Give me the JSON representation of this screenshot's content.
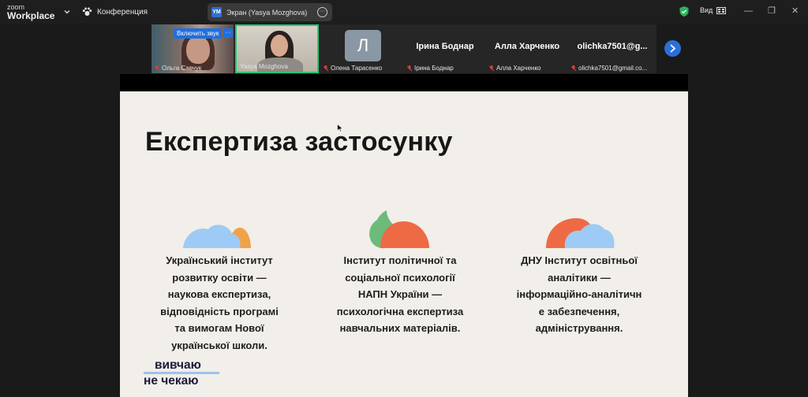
{
  "app": {
    "logo_line1": "zoom",
    "logo_line2": "Workplace",
    "meeting_label": "Конференция",
    "share_initials": "YM",
    "share_label": "Экран (Yasya Mozghova)",
    "view_label": "Вид"
  },
  "participants": {
    "unmute_label": "Включить звук",
    "tiles": [
      {
        "name": "Ольга Савчук"
      },
      {
        "name": "Yasya Mozghova"
      },
      {
        "name": "Олена Тарасенко",
        "avatar_letter": "Л"
      },
      {
        "name": "Ірина Боднар",
        "display_name": "Ірина Боднар"
      },
      {
        "name": "Алла Харченко",
        "display_name": "Алла Харченко"
      },
      {
        "name": "olichka7501@gmail.co...",
        "display_name": "olichka7501@g..."
      }
    ]
  },
  "slide": {
    "title": "Експертиза застосунку",
    "orgs": [
      {
        "lines": [
          "Український інститут",
          "розвитку освіти —",
          "наукова експертиза,",
          "відповідність програмі",
          "та вимогам Нової",
          "української школи."
        ]
      },
      {
        "lines": [
          "Інститут політичної та",
          "соціальної психології",
          "НАПН України —",
          "психологічна експертиза",
          "навчальних матеріалів."
        ]
      },
      {
        "lines": [
          "ДНУ Інститут освітньої",
          "аналітики —",
          "інформаційно-аналітичн",
          "е забезпечення,",
          "адміністрування."
        ]
      }
    ],
    "brand_line1": "вивчаю",
    "brand_line2": "не чекаю"
  },
  "colors": {
    "accent_blue": "#2d6fd8",
    "active_speaker": "#28c76f",
    "shape_blue": "#9ecbf5",
    "shape_orange": "#f0a24a",
    "shape_green": "#6cbb7a",
    "shape_red": "#ee6a45"
  }
}
